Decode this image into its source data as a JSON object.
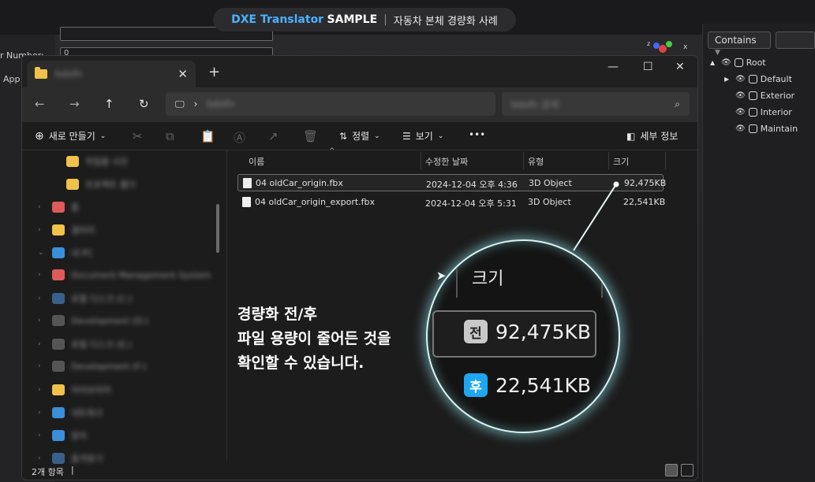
{
  "banner": {
    "brand_blue": "DXE Translator",
    "brand_white": "SAMPLE",
    "separator": "|",
    "subtitle": "자동차 본체 경량화 사례"
  },
  "background_left": {
    "label_number": "r Number:",
    "field_value": "0",
    "label_app": "App"
  },
  "background_right": {
    "contains_label": "Contains",
    "tree": [
      {
        "label": "Root",
        "level": 0,
        "arrow": "▲"
      },
      {
        "label": "Default",
        "level": 1,
        "arrow": "▶"
      },
      {
        "label": "Exterior",
        "level": 1,
        "arrow": ""
      },
      {
        "label": "Interior",
        "level": 1,
        "arrow": ""
      },
      {
        "label": "Maintain",
        "level": 1,
        "arrow": ""
      }
    ]
  },
  "explorer": {
    "tab_label": "bdxfn",
    "tab_close": "✕",
    "new_tab": "+",
    "window_controls": {
      "minimize": "—",
      "maximize": "☐",
      "close": "✕"
    },
    "nav": {
      "back": "←",
      "forward": "→",
      "up": "↑",
      "refresh": "↻"
    },
    "address": {
      "monitor": "🖵",
      "chevron": "›",
      "path": "bdxfn"
    },
    "search": {
      "placeholder": "bdxfn 검색",
      "icon": "⌕"
    },
    "toolbar": {
      "new_label": "새로 만들기",
      "sort_label": "정렬",
      "view_label": "보기",
      "more": "•••",
      "details_label": "세부 정보",
      "chevron": "⌄"
    },
    "columns": {
      "name": "이름",
      "date": "수정한 날짜",
      "type": "유형",
      "size": "크기"
    },
    "files": [
      {
        "name": "04 oldCar_origin.fbx",
        "date": "2024-12-04 오후 4:36",
        "type": "3D Object",
        "size": "92,475KB",
        "selected": true
      },
      {
        "name": "04 oldCar_origin_export.fbx",
        "date": "2024-12-04 오후 5:31",
        "type": "3D Object",
        "size": "22,541KB",
        "selected": false
      }
    ],
    "sidebar_items": [
      {
        "text": "작업용 사진",
        "color": "#f0c24a",
        "chev": ""
      },
      {
        "text": "프로젝트 폴더",
        "color": "#f0c24a",
        "chev": ""
      },
      {
        "text": "홈",
        "color": "#e05a5a",
        "chev": "›"
      },
      {
        "text": "갤러리",
        "color": "#f0c24a",
        "chev": "›"
      },
      {
        "text": "내 PC",
        "color": "#3a8fd8",
        "chev": "⌄"
      },
      {
        "text": "Document Management System",
        "color": "#e05a5a",
        "chev": "›"
      },
      {
        "text": "로컬 디스크 (C:)",
        "color": "#3a5f8a",
        "chev": "›"
      },
      {
        "text": "Development (D:)",
        "color": "#555",
        "chev": "›"
      },
      {
        "text": "로컬 디스크 (E:)",
        "color": "#555",
        "chev": "›"
      },
      {
        "text": "Development (F:)",
        "color": "#555",
        "chev": "›"
      },
      {
        "text": "라이브러리",
        "color": "#f0c24a",
        "chev": "›"
      },
      {
        "text": "네트워크",
        "color": "#3a8fd8",
        "chev": "›"
      },
      {
        "text": "장치",
        "color": "#3a8fd8",
        "chev": "›"
      },
      {
        "text": "즐겨찾기",
        "color": "#3a5f8a",
        "chev": "›"
      }
    ],
    "status_count": "2개 항목",
    "status_cursor": "|"
  },
  "caption": {
    "line1": "경량화 전/후",
    "line2": "파일 용량이 줄어든 것을",
    "line3": "확인할 수 있습니다."
  },
  "zoom": {
    "header": "크기",
    "before_badge": "전",
    "before_value": "92,475KB",
    "after_badge": "후",
    "after_value": "22,541KB"
  },
  "colors": {
    "accent_blue": "#4ab3ff",
    "glow": "#d9f3f3",
    "after_badge": "#1ea7f0",
    "before_badge": "#c9c9c9"
  }
}
